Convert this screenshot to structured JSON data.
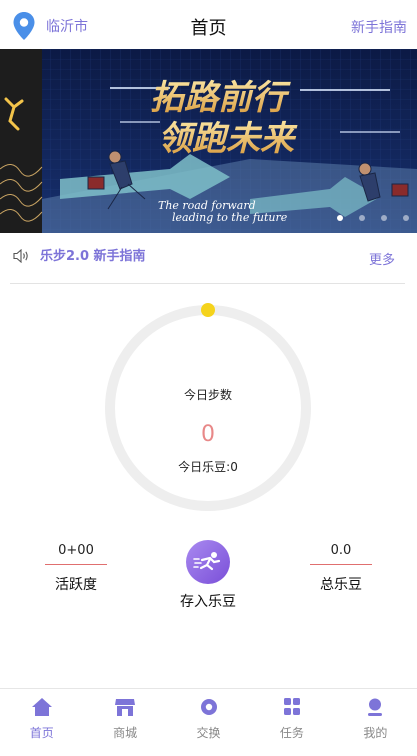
{
  "header": {
    "city": "临沂市",
    "title": "首页",
    "guide": "新手指南"
  },
  "banner": {
    "headline_1": "拓路前行",
    "headline_2": "领跑未来",
    "subline_1": "The road forward",
    "subline_2": "leading to the future",
    "slide_count": 4,
    "active_slide": 1
  },
  "notice": {
    "text": "乐步2.0 新手指南",
    "more": "更多"
  },
  "ring": {
    "steps_label": "今日步数",
    "steps_value": "0",
    "beans_line": "今日乐豆:0"
  },
  "stats": {
    "activity_value": "0+00",
    "activity_label": "活跃度",
    "deposit_label": "存入乐豆",
    "total_value": "0.0",
    "total_label": "总乐豆"
  },
  "nav": {
    "items": [
      {
        "label": "首页",
        "icon": "home-icon",
        "active": true
      },
      {
        "label": "商城",
        "icon": "shop-icon",
        "active": false
      },
      {
        "label": "交换",
        "icon": "exchange-icon",
        "active": false
      },
      {
        "label": "任务",
        "icon": "tasks-icon",
        "active": false
      },
      {
        "label": "我的",
        "icon": "profile-icon",
        "active": false
      }
    ]
  },
  "colors": {
    "accent": "#7d74d8",
    "progress_knob": "#f5d31c",
    "steps_value": "#e88888",
    "ring_track": "#eeeeee"
  }
}
